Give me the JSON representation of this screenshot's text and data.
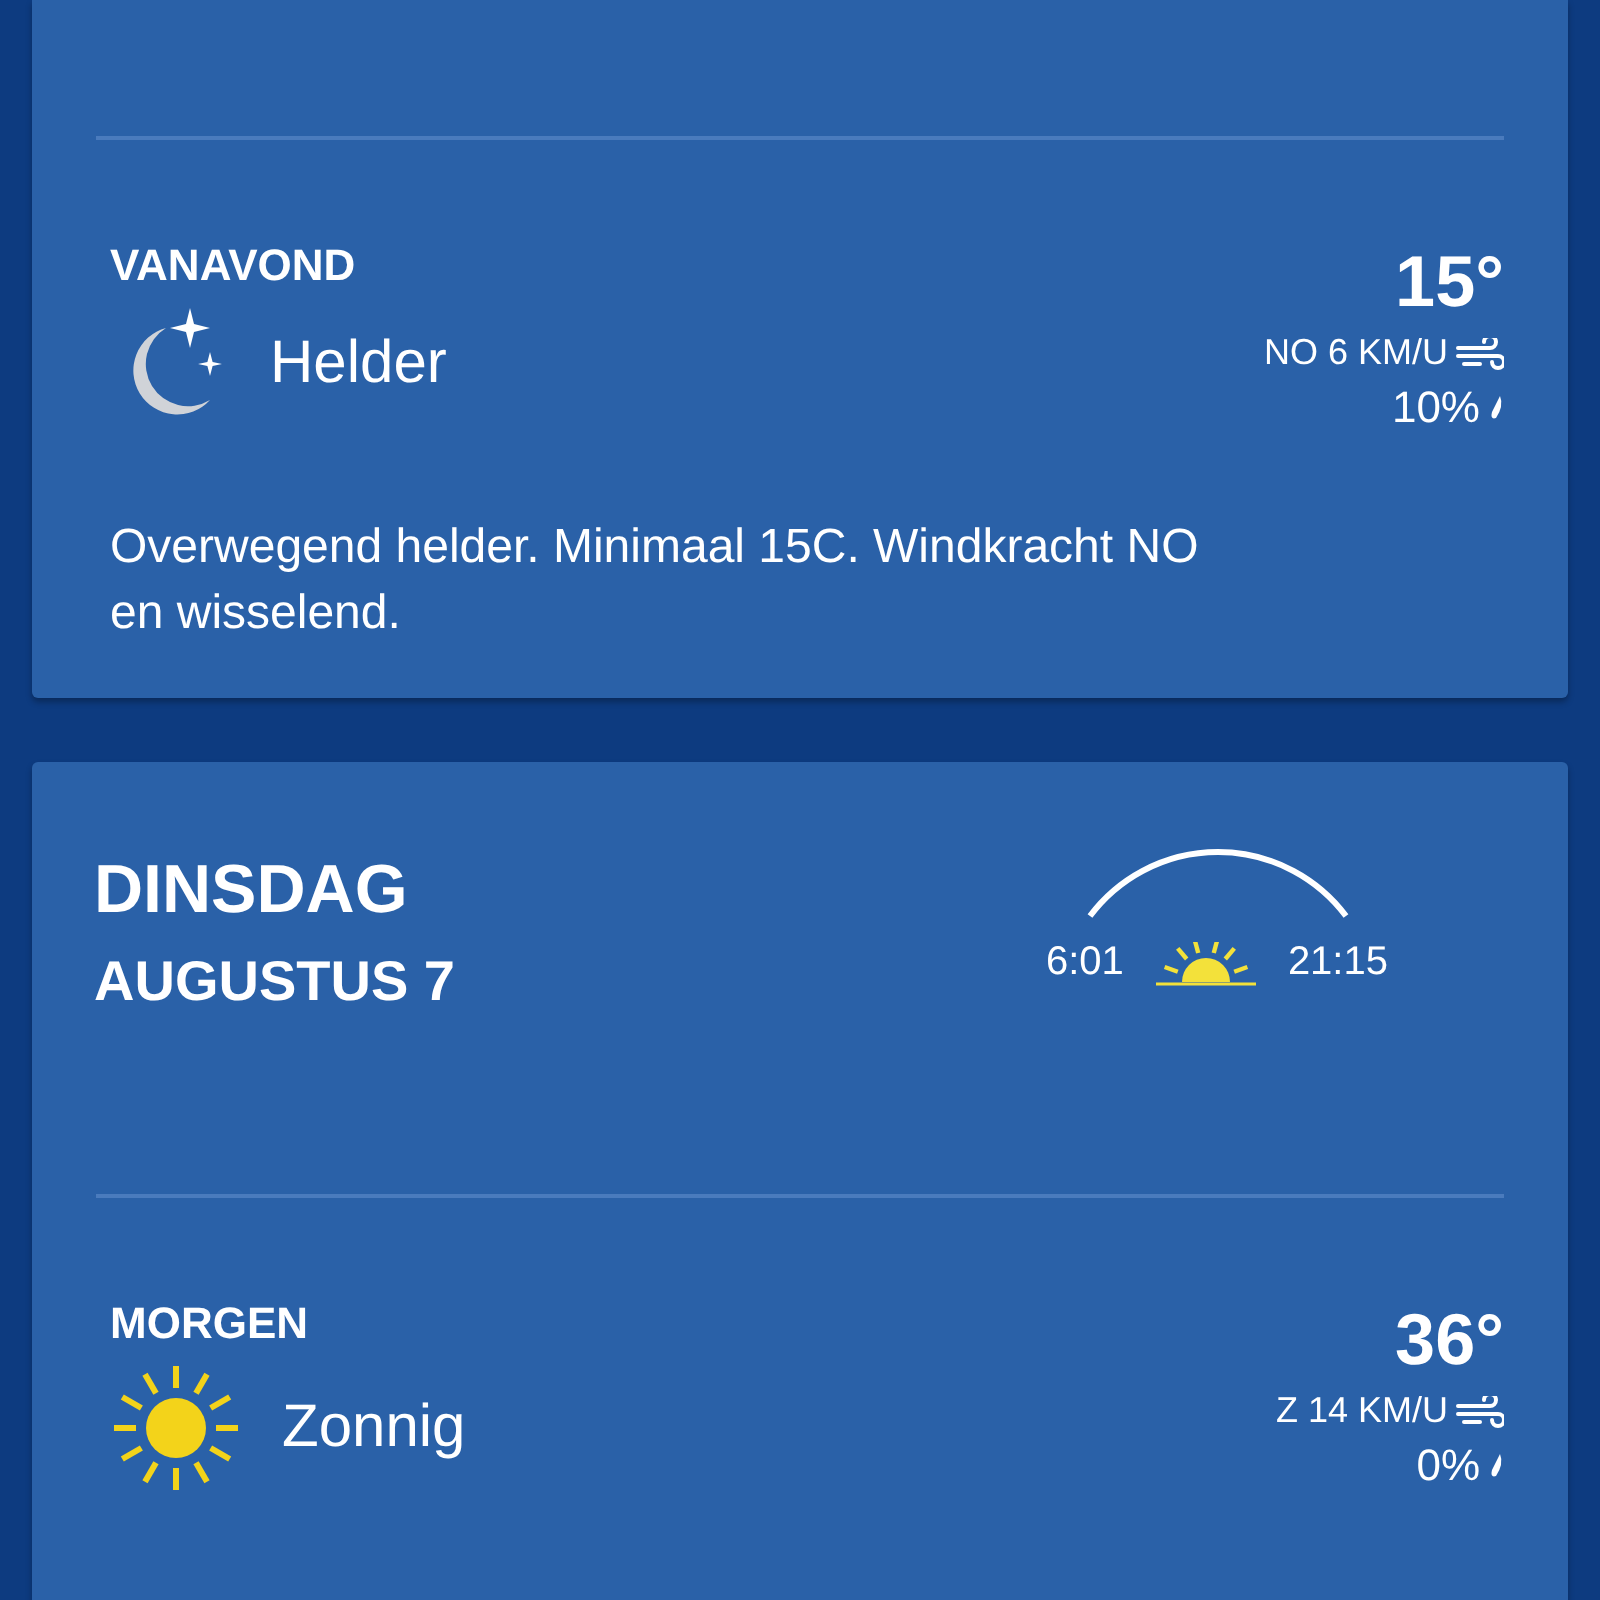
{
  "cards": [
    {
      "periods": [
        {
          "label": "VANAVOND",
          "kind": "night",
          "condition": "Helder",
          "temperature": "15°",
          "wind": "NO 6 KM/U",
          "rain": "10%",
          "description": "Overwegend helder. Minimaal 15C. Windkracht NO en wisselend."
        }
      ]
    },
    {
      "header": {
        "day": "DINSDAG",
        "date": "AUGUSTUS 7",
        "sunrise": "6:01",
        "sunset": "21:15"
      },
      "periods": [
        {
          "label": "MORGEN",
          "kind": "sunny",
          "condition": "Zonnig",
          "temperature": "36°",
          "wind": "Z 14 KM/U",
          "rain": "0%"
        }
      ]
    }
  ]
}
